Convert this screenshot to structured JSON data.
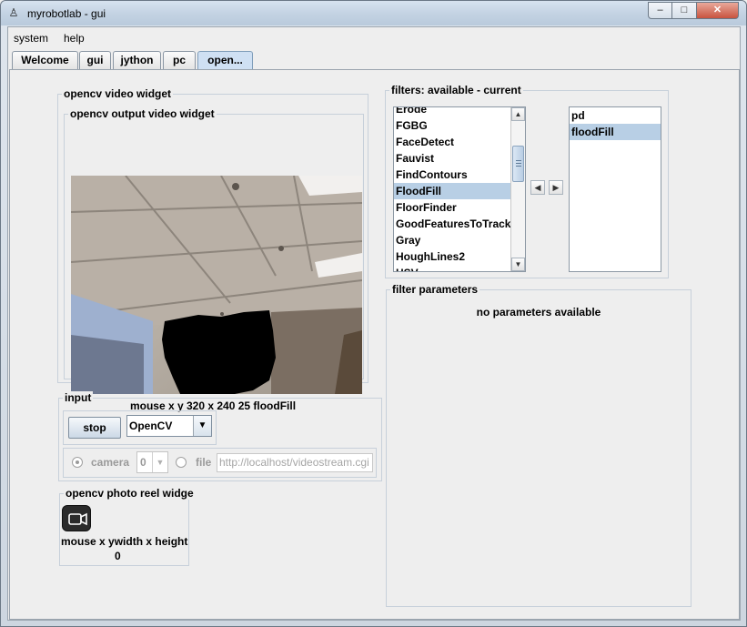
{
  "window": {
    "title": "myrobotlab - gui",
    "minimize_glyph": "–",
    "maximize_glyph": "□",
    "close_glyph": "✕",
    "app_icon": "robot-icon"
  },
  "menu": {
    "items": [
      "system",
      "help"
    ]
  },
  "tabs": [
    {
      "label": "Welcome",
      "active": false
    },
    {
      "label": "gui",
      "active": false
    },
    {
      "label": "jython",
      "active": false
    },
    {
      "label": "pc",
      "active": false
    },
    {
      "label": "open...",
      "active": true
    }
  ],
  "video_widget": {
    "group_label": "opencv  video widget",
    "output_label": "opencv output video widget",
    "status": "mouse x y  320 x 240  25  floodFill"
  },
  "input": {
    "group_label": "input",
    "stop_label": "stop",
    "source_value": "OpenCV",
    "camera_label": "camera",
    "camera_index": "0",
    "file_label": "file",
    "file_placeholder": "http://localhost/videostream.cgi"
  },
  "photo_reel": {
    "group_label": "opencv  photo reel widge",
    "camera_icon": "video-camera-icon",
    "status_line1": "mouse x ywidth x height",
    "status_line2": "0"
  },
  "filters": {
    "group_label": "filters: available - current",
    "available": [
      "Erode",
      "FGBG",
      "FaceDetect",
      "Fauvist",
      "FindContours",
      "FloodFill",
      "FloorFinder",
      "GoodFeaturesToTrack",
      "Gray",
      "HoughLines2",
      "HSV"
    ],
    "available_selected": "FloodFill",
    "current": [
      "pd",
      "floodFill"
    ],
    "current_selected": "floodFill",
    "left_arrow": "◀",
    "right_arrow": "▶"
  },
  "filter_parameters": {
    "group_label": "filter parameters",
    "message": "no parameters available"
  },
  "colors": {
    "selection": "#b8cfe5",
    "active_tab": "#cfe0f3"
  }
}
